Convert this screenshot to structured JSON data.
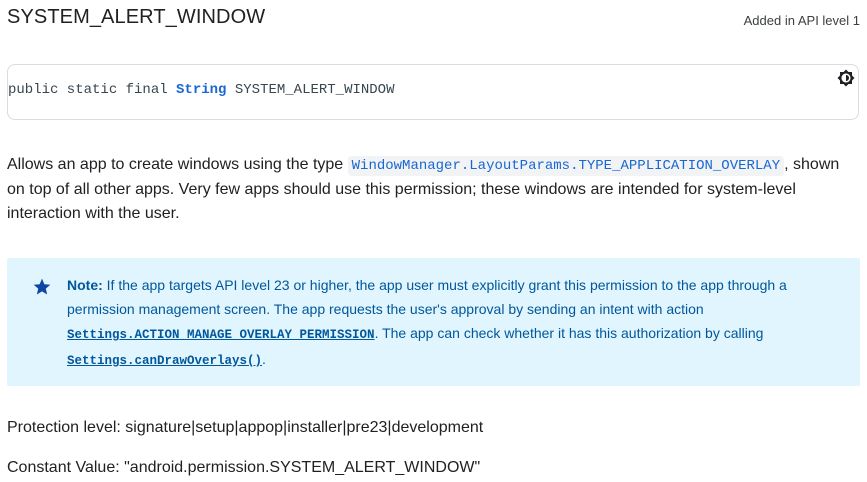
{
  "header": {
    "title": "SYSTEM_ALERT_WINDOW",
    "api_level": "Added in API level 1"
  },
  "signature": {
    "prefix": "public static final ",
    "type": "String",
    "name": " SYSTEM_ALERT_WINDOW"
  },
  "theme_toggle": {
    "icon": "brightness-icon"
  },
  "description": {
    "before": "Allows an app to create windows using the type ",
    "code": "WindowManager.LayoutParams.TYPE_APPLICATION_OVERLAY",
    "after": ", shown on top of all other apps. Very few apps should use this permission; these windows are intended for system-level interaction with the user."
  },
  "note": {
    "icon": "star-icon",
    "label": "Note:",
    "text1": " If the app targets API level 23 or higher, the app user must explicitly grant this permission to the app through a permission management screen. The app requests the user's approval by sending an intent with action ",
    "link1": "Settings.ACTION_MANAGE_OVERLAY_PERMISSION",
    "text2": ". The app can check whether it has this authorization by calling ",
    "link2": "Settings.canDrawOverlays()",
    "text3": "."
  },
  "protection_level": "Protection level: signature|setup|appop|installer|pre23|development",
  "constant_value": "Constant Value: \"android.permission.SYSTEM_ALERT_WINDOW\"",
  "colors": {
    "note_background": "#e1f5fe",
    "note_text": "#01579b",
    "code_link": "#1967d2"
  }
}
